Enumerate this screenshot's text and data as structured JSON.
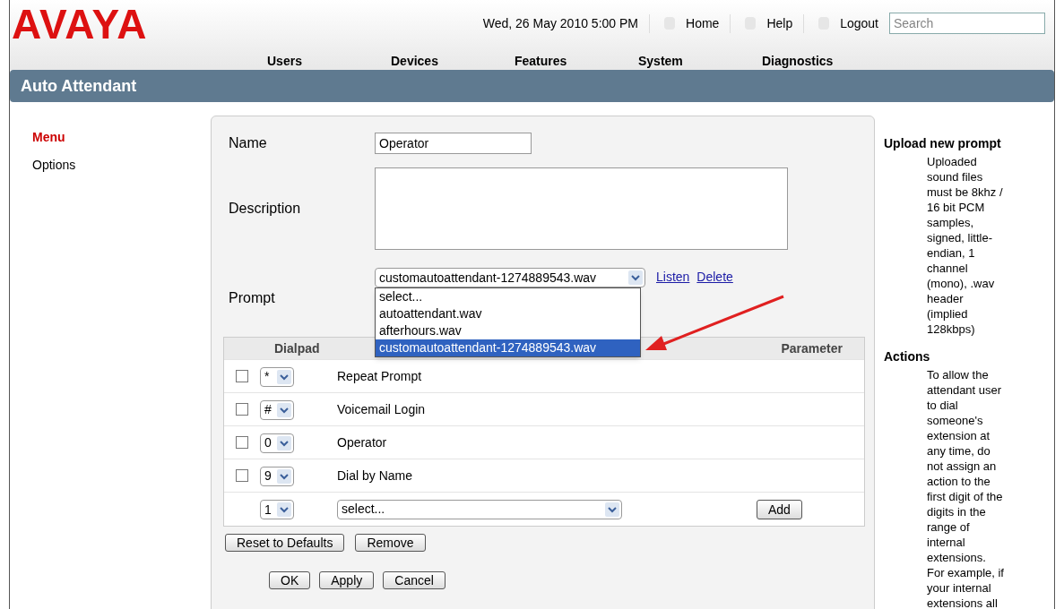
{
  "header": {
    "logo": "AVAYA",
    "datetime": "Wed, 26 May 2010 5:00 PM",
    "links": [
      "Home",
      "Help",
      "Logout"
    ],
    "search": {
      "placeholder": "Search"
    }
  },
  "nav": [
    "Users",
    "Devices",
    "Features",
    "System",
    "Diagnostics"
  ],
  "page_title": "Auto Attendant",
  "sidebar": [
    {
      "label": "Menu",
      "selected": true
    },
    {
      "label": "Options",
      "selected": false
    }
  ],
  "form": {
    "name_label": "Name",
    "name_value": "Operator",
    "description_label": "Description",
    "prompt_label": "Prompt",
    "prompt_value": "customautoattendant-1274889543.wav",
    "listen": "Listen",
    "delete": "Delete",
    "prompt_options": [
      {
        "label": "select...",
        "selected": false
      },
      {
        "label": "autoattendant.wav",
        "selected": false
      },
      {
        "label": "afterhours.wav",
        "selected": false
      },
      {
        "label": "customautoattendant-1274889543.wav",
        "selected": true
      }
    ]
  },
  "table": {
    "columns": [
      "Dialpad",
      "Parameter"
    ],
    "rows": [
      {
        "checked": false,
        "key": "*",
        "action": "Repeat Prompt"
      },
      {
        "checked": false,
        "key": "#",
        "action": "Voicemail Login"
      },
      {
        "checked": false,
        "key": "0",
        "action": "Operator"
      },
      {
        "checked": false,
        "key": "9",
        "action": "Dial by Name"
      }
    ],
    "new_row": {
      "key": "1",
      "action": "select...",
      "button": "Add"
    }
  },
  "table_buttons": [
    "Reset to Defaults",
    "Remove"
  ],
  "buttons": [
    "OK",
    "Apply",
    "Cancel"
  ],
  "help": [
    {
      "title": "Upload new prompt",
      "text": "Uploaded sound files must be 8khz / 16 bit PCM samples, signed, little-endian, 1 channel (mono), .wav header (implied 128kbps)"
    },
    {
      "title": "Actions",
      "text": "To allow the attendant user to dial someone's extension at any time, do not assign an action to the first digit of the digits in the range of internal extensions. For example, if your internal extensions all"
    }
  ]
}
